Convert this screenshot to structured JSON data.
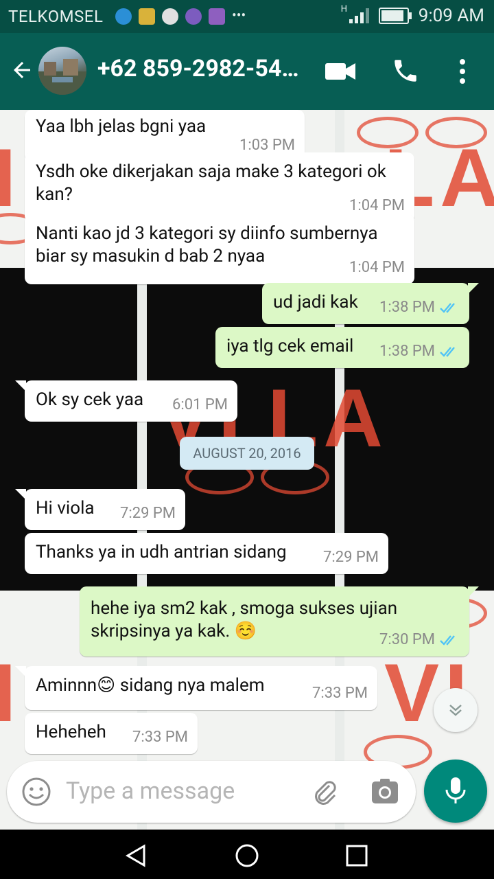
{
  "status_bar": {
    "carrier": "TELKOMSEL",
    "time": "9:09 AM",
    "network_type": "H",
    "notification_icons": [
      "messenger-icon",
      "clipboard-icon",
      "starbucks-icon",
      "p-icon",
      "gallery-icon",
      "more-dots-icon"
    ],
    "battery_level": 0.9
  },
  "header": {
    "contact": "+62 859-2982-54…"
  },
  "messages": [
    {
      "dir": "in",
      "text": "Yaa lbh jelas bgni yaa",
      "time": "1:03 PM"
    },
    {
      "dir": "in",
      "text": "Ysdh oke dikerjakan saja make 3 kategori ok kan?",
      "time": "1:04 PM"
    },
    {
      "dir": "in",
      "text": "Nanti kao jd 3 kategori sy diinfo sumbernya biar sy masukin d bab 2 nyaa",
      "time": "1:04 PM"
    },
    {
      "dir": "out",
      "text": "ud jadi kak",
      "time": "1:38 PM"
    },
    {
      "dir": "out",
      "text": "iya tlg cek email",
      "time": "1:38 PM"
    },
    {
      "dir": "in",
      "text": "Ok sy cek yaa",
      "time": "6:01 PM"
    },
    {
      "dir": "in",
      "text": "Hi viola",
      "time": "7:29 PM"
    },
    {
      "dir": "in",
      "text": "Thanks ya in udh antrian sidang",
      "time": "7:29 PM"
    },
    {
      "dir": "out",
      "text": "hehe iya sm2 kak , smoga sukses ujian skripsinya ya kak. ☺️",
      "time": "7:30 PM"
    },
    {
      "dir": "in",
      "text": "Aminnn😊 sidang nya malem",
      "time": "7:33 PM"
    },
    {
      "dir": "in",
      "text": "Heheheh",
      "time": "7:33 PM"
    }
  ],
  "date_separator": "AUGUST 20, 2016",
  "input": {
    "placeholder": "Type a message"
  },
  "colors": {
    "header": "#075e54",
    "status_bar": "#064e44",
    "outgoing_bubble": "#dcf8c6",
    "incoming_bubble": "#ffffff",
    "read_ticks": "#4fc3f7",
    "mic_button": "#00897b"
  }
}
